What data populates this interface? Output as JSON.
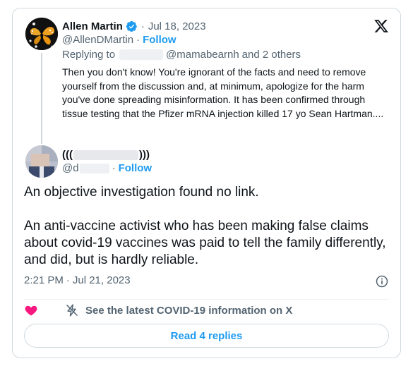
{
  "parent_tweet": {
    "author_name": "Allen Martin",
    "separator": "·",
    "date": "Jul 18, 2023",
    "handle": "@AllenDMartin",
    "follow_label": "Follow",
    "replying_prefix": "Replying to",
    "replying_handle": "@mamabearnh",
    "replying_others": "and 2 others",
    "text": "Then you don't know! You're ignorant of the facts and need to remove yourself from the discussion and, at minimum, apologize for the harm you've done spreading misinformation. It has been confirmed through tissue testing that the Pfizer mRNA injection killed 17 yo Sean Hartman...."
  },
  "reply_tweet": {
    "name_prefix": "(((",
    "name_suffix": ")))",
    "handle_prefix": "@d",
    "follow_label": "Follow",
    "paragraphs": [
      "An objective investigation found no link.",
      "An anti-vaccine activist who has been making false claims about covid-19 vaccines was paid to tell the family differently, and did, but is hardly reliable."
    ],
    "time": "2:21 PM",
    "date": "Jul 21, 2023"
  },
  "actions": {
    "covid_label": "See the latest COVID-19 information on X",
    "read_replies_label": "Read 4 replies"
  },
  "colors": {
    "accent": "#1d9bf0",
    "heart": "#f91880",
    "secondary_text": "#536471",
    "border": "#cfd9de"
  },
  "icons": {
    "brand": "x-logo-icon",
    "verified": "verified-badge-icon",
    "info": "info-icon",
    "like": "heart-icon",
    "covid": "lightning-icon"
  }
}
